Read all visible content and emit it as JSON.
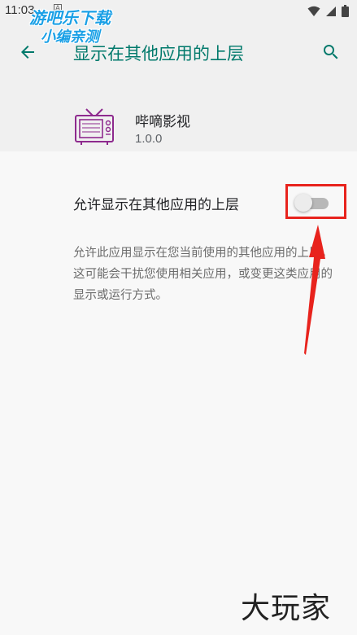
{
  "status_bar": {
    "time": "11:03",
    "notification_icon": "A",
    "icons": [
      "wifi-icon",
      "signal-icon",
      "battery-icon"
    ]
  },
  "watermark_top": {
    "line1": "游吧乐下载",
    "line2": "小编亲测"
  },
  "app_bar": {
    "back_icon": "arrow-back-icon",
    "title": "显示在其他应用的上层",
    "search_icon": "search-icon"
  },
  "app": {
    "name": "哔嘀影视",
    "version": "1.0.0",
    "icon": "tv-icon"
  },
  "setting": {
    "label": "允许显示在其他应用的上层",
    "enabled": false
  },
  "description": "允许此应用显示在您当前使用的其他应用的上层。这可能会干扰您使用相关应用，或变更这类应用的显示或运行方式。",
  "watermark_bottom": "大玩家",
  "colors": {
    "accent": "#00796b",
    "annotation_red": "#e8231d",
    "app_icon": "#8e2a8e",
    "background": "#f8f8f8",
    "header_background": "#f0f0f0"
  }
}
